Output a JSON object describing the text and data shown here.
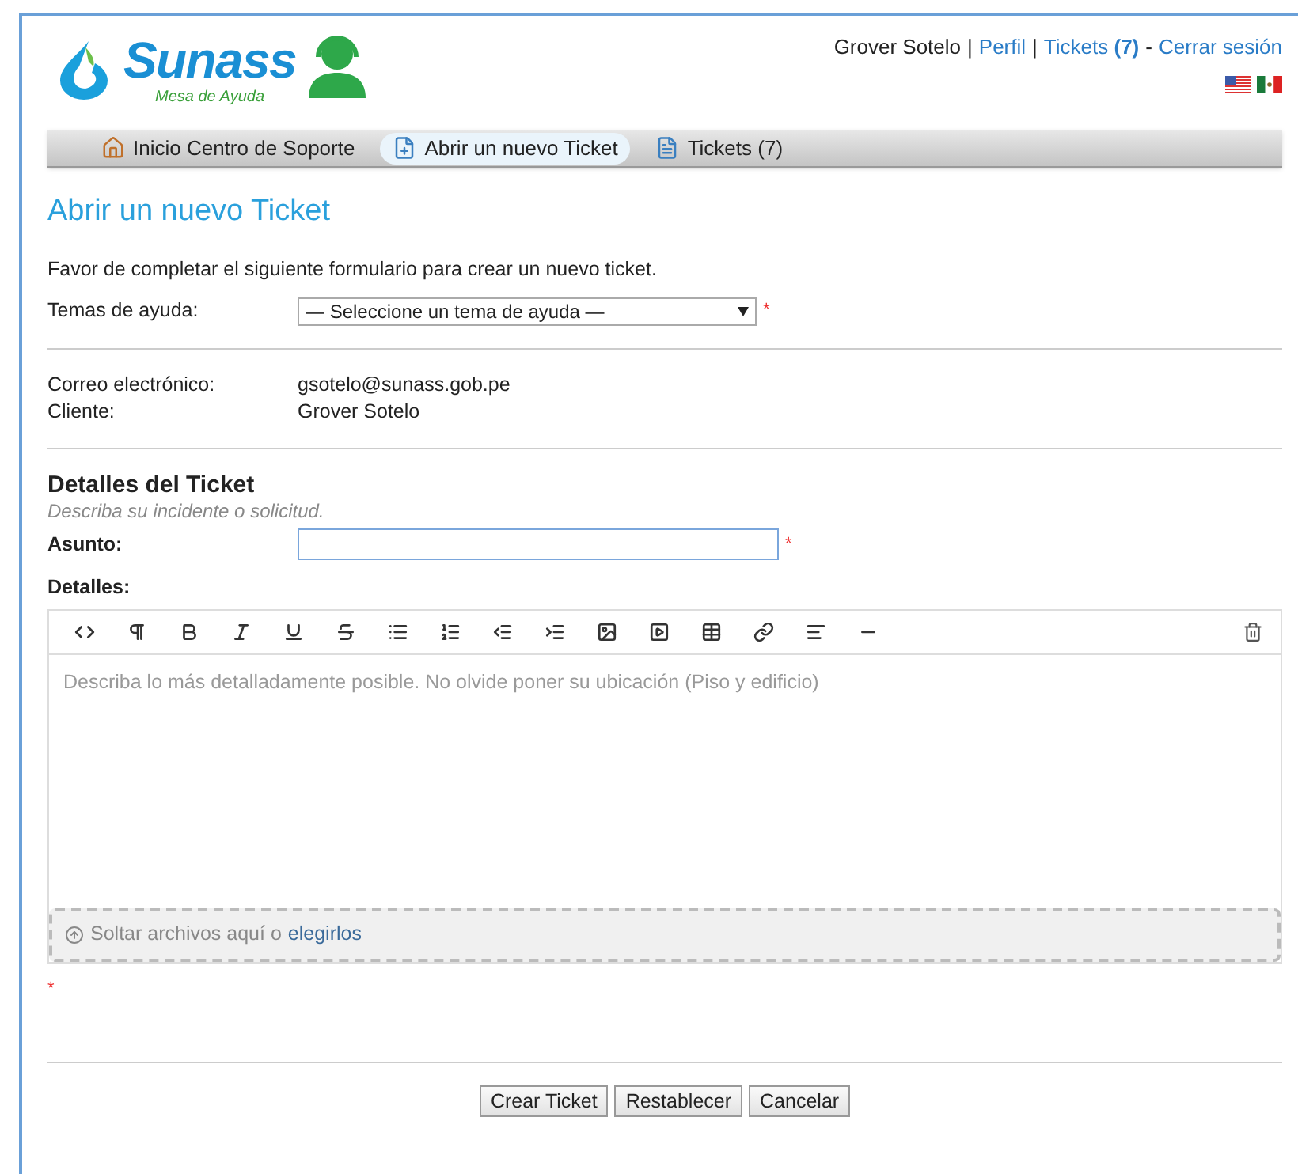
{
  "logo": {
    "name": "Sunass",
    "tagline": "Mesa de Ayuda"
  },
  "user_bar": {
    "user": "Grover Sotelo",
    "links": [
      {
        "label": "Perfil",
        "sep": "|"
      },
      {
        "label": "Tickets **(7)**",
        "sep": "|"
      },
      {
        "label": "Cerrar sesión",
        "sep": "-"
      }
    ]
  },
  "nav": [
    {
      "label": "Inicio Centro de Soporte",
      "selected": false
    },
    {
      "label": "Abrir un nuevo Ticket",
      "selected": true
    },
    {
      "label": "Tickets (7)",
      "selected": false
    }
  ],
  "page_title": "Abrir un nuevo Ticket",
  "intro": "Favor de completar el siguiente formulario para crear un nuevo ticket.",
  "help_topic": {
    "label": "Temas de ayuda:",
    "value": "— Seleccione un tema de ayuda —",
    "required_mark": "*"
  },
  "contact": [
    {
      "label": "Correo electrónico:",
      "value": "gsotelo@sunass.gob.pe"
    },
    {
      "label": "Cliente:",
      "value": "Grover Sotelo"
    }
  ],
  "details": {
    "title": "Detalles del Ticket",
    "subtitle": "Describa su incidente o solicitud.",
    "subject_label": "Asunto:",
    "subject_required_mark": "*",
    "details_label": "Detalles:",
    "editor_placeholder": "Describa lo más detalladamente posible. No olvide poner su ubicación (Piso y edificio)",
    "drop_text": "Soltar archivos aquí o",
    "drop_link": "elegirlos",
    "required_mark": "*"
  },
  "buttons": [
    "Crear Ticket",
    "Restablecer",
    "Cancelar"
  ]
}
